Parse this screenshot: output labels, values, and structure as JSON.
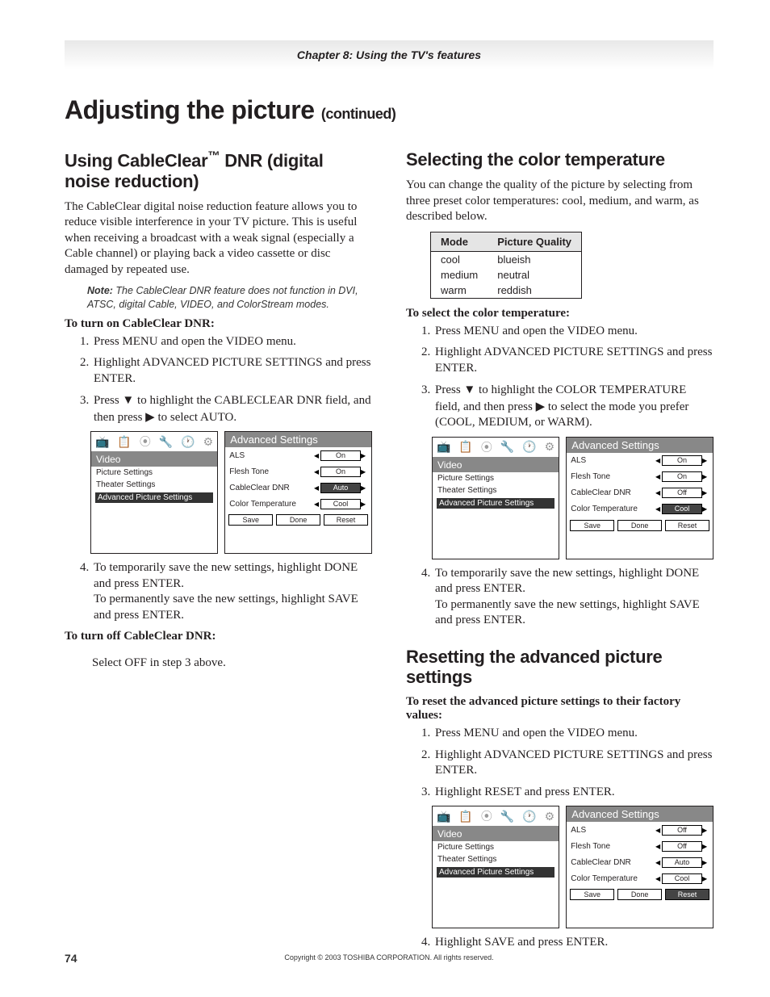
{
  "chapter": "Chapter 8: Using the TV's features",
  "page_title": "Adjusting the picture",
  "page_title_cont": "(continued)",
  "left": {
    "h2_pre": "Using CableClear",
    "h2_tm": "™",
    "h2_post": " DNR (digital noise reduction)",
    "intro": "The CableClear digital noise reduction feature allows you to reduce visible interference in your TV picture. This is useful when receiving a broadcast with a weak signal (especially a Cable channel) or playing back a video cassette or disc damaged by repeated use.",
    "note_label": "Note:",
    "note_text": " The CableClear DNR feature does not function in DVI, ATSC, digital Cable, VIDEO, and ColorStream modes.",
    "turn_on_head": "To turn on CableClear DNR:",
    "steps_on": {
      "s1": "Press MENU and open the VIDEO menu.",
      "s2": "Highlight ADVANCED PICTURE SETTINGS and press ENTER.",
      "s3a": "Press ",
      "s3b": " to highlight the CABLECLEAR DNR field, and then press ",
      "s3c": " to select AUTO."
    },
    "menu1": {
      "video_head": "Video",
      "items": [
        "Picture Settings",
        "Theater Settings",
        "Advanced Picture Settings"
      ],
      "adv_head": "Advanced Settings",
      "rows": [
        {
          "lbl": "ALS",
          "val": "On",
          "sel": false
        },
        {
          "lbl": "Flesh Tone",
          "val": "On",
          "sel": false
        },
        {
          "lbl": "CableClear DNR",
          "val": "Auto",
          "sel": true
        },
        {
          "lbl": "Color Temperature",
          "val": "Cool",
          "sel": false
        }
      ],
      "btns": [
        "Save",
        "Done",
        "Reset"
      ],
      "btn_sel": -1
    },
    "s4a": "To temporarily save the new settings, highlight DONE and press ENTER.",
    "s4b": "To permanently save the new settings, highlight SAVE and press ENTER.",
    "turn_off_head": "To turn off CableClear DNR:",
    "turn_off_body": "Select OFF in step 3 above."
  },
  "right": {
    "sec1_h2": "Selecting the color temperature",
    "sec1_intro": "You can change the quality of the picture by selecting from three preset color temperatures: cool, medium, and warm, as described below.",
    "table": {
      "h1": "Mode",
      "h2": "Picture Quality",
      "rows": [
        {
          "m": "cool",
          "q": "blueish"
        },
        {
          "m": "medium",
          "q": "neutral"
        },
        {
          "m": "warm",
          "q": "reddish"
        }
      ]
    },
    "sel_head": "To select the color temperature:",
    "steps_sel": {
      "s1": "Press MENU and open the VIDEO menu.",
      "s2": "Highlight ADVANCED PICTURE SETTINGS and press ENTER.",
      "s3a": "Press ",
      "s3b": " to highlight the COLOR TEMPERATURE field, and then press ",
      "s3c": " to select the mode you prefer (COOL, MEDIUM, or WARM)."
    },
    "menu2": {
      "video_head": "Video",
      "items": [
        "Picture Settings",
        "Theater Settings",
        "Advanced Picture Settings"
      ],
      "adv_head": "Advanced Settings",
      "rows": [
        {
          "lbl": "ALS",
          "val": "On",
          "sel": false
        },
        {
          "lbl": "Flesh Tone",
          "val": "On",
          "sel": false
        },
        {
          "lbl": "CableClear DNR",
          "val": "Off",
          "sel": false
        },
        {
          "lbl": "Color Temperature",
          "val": "Cool",
          "sel": true
        }
      ],
      "btns": [
        "Save",
        "Done",
        "Reset"
      ],
      "btn_sel": -1
    },
    "s4a": "To temporarily save the new settings, highlight DONE and press ENTER.",
    "s4b": "To permanently save the new settings, highlight SAVE and press ENTER.",
    "sec2_h2": "Resetting the advanced picture settings",
    "reset_head": "To reset the advanced picture settings to their factory values:",
    "steps_reset": {
      "s1": "Press MENU and open the VIDEO menu.",
      "s2": "Highlight ADVANCED PICTURE SETTINGS and press ENTER.",
      "s3": "Highlight RESET and press ENTER."
    },
    "menu3": {
      "video_head": "Video",
      "items": [
        "Picture Settings",
        "Theater Settings",
        "Advanced Picture Settings"
      ],
      "adv_head": "Advanced Settings",
      "rows": [
        {
          "lbl": "ALS",
          "val": "Off",
          "sel": false
        },
        {
          "lbl": "Flesh Tone",
          "val": "Off",
          "sel": false
        },
        {
          "lbl": "CableClear DNR",
          "val": "Auto",
          "sel": false
        },
        {
          "lbl": "Color Temperature",
          "val": "Cool",
          "sel": false
        }
      ],
      "btns": [
        "Save",
        "Done",
        "Reset"
      ],
      "btn_sel": 2
    },
    "s4c": "Highlight SAVE and press ENTER."
  },
  "footer": {
    "page": "74",
    "copyright": "Copyright © 2003 TOSHIBA CORPORATION. All rights reserved."
  }
}
